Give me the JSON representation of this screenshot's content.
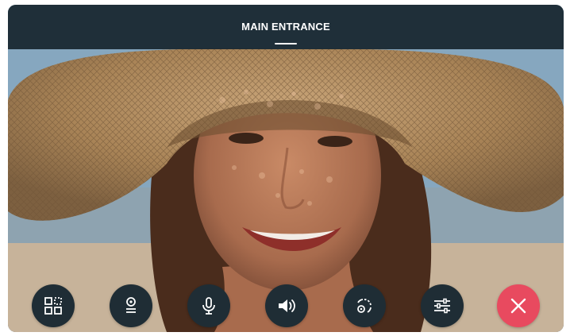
{
  "header": {
    "title": "MAIN ENTRANCE"
  },
  "controls": [
    {
      "name": "layout-grid-button",
      "icon": "grid-layout-icon",
      "active": false
    },
    {
      "name": "camera-button",
      "icon": "camera-icon",
      "active": false
    },
    {
      "name": "microphone-button",
      "icon": "microphone-icon",
      "active": false
    },
    {
      "name": "speaker-button",
      "icon": "speaker-volume-icon",
      "active": false
    },
    {
      "name": "switch-camera-button",
      "icon": "switch-camera-icon",
      "active": false
    },
    {
      "name": "settings-button",
      "icon": "sliders-icon",
      "active": false
    },
    {
      "name": "end-call-button",
      "icon": "close-icon",
      "active": false
    }
  ],
  "colors": {
    "header_bg": "#18262e",
    "button_bg": "#1f2d35",
    "end_call": "#e84a5f",
    "icon": "#ffffff"
  }
}
